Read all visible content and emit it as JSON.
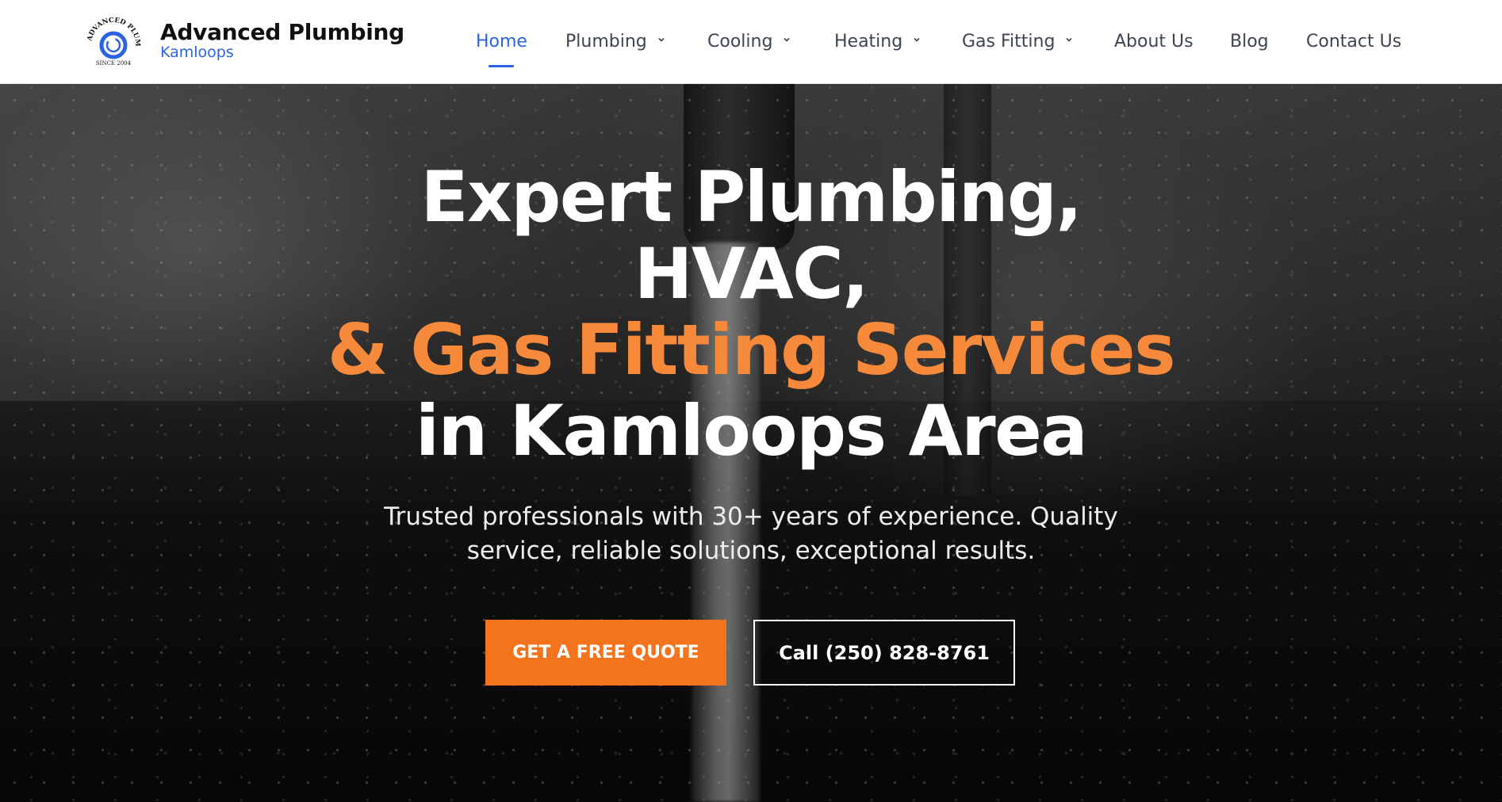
{
  "brand": {
    "logo_text_top": "ADVANCED PLUMBING",
    "logo_text_bottom": "SINCE 2004",
    "name": "Advanced Plumbing",
    "location": "Kamloops"
  },
  "nav": {
    "items": [
      {
        "label": "Home",
        "active": true,
        "dropdown": false
      },
      {
        "label": "Plumbing",
        "active": false,
        "dropdown": true
      },
      {
        "label": "Cooling",
        "active": false,
        "dropdown": true
      },
      {
        "label": "Heating",
        "active": false,
        "dropdown": true
      },
      {
        "label": "Gas Fitting",
        "active": false,
        "dropdown": true
      },
      {
        "label": "About Us",
        "active": false,
        "dropdown": false
      },
      {
        "label": "Blog",
        "active": false,
        "dropdown": false
      },
      {
        "label": "Contact Us",
        "active": false,
        "dropdown": false
      }
    ]
  },
  "hero": {
    "line1": "Expert Plumbing,",
    "line2": "HVAC,",
    "line3": "& Gas Fitting Services",
    "line4": "in Kamloops Area",
    "subtitle_line1": "Trusted professionals with 30+ years of experience. Quality",
    "subtitle_line2": "service, reliable solutions, exceptional results.",
    "cta_primary": "GET A FREE QUOTE",
    "cta_secondary": "Call (250) 828-8761"
  },
  "colors": {
    "accent_blue": "#2b63e0",
    "accent_orange": "#f4741e",
    "headline_orange": "#f6893a"
  }
}
